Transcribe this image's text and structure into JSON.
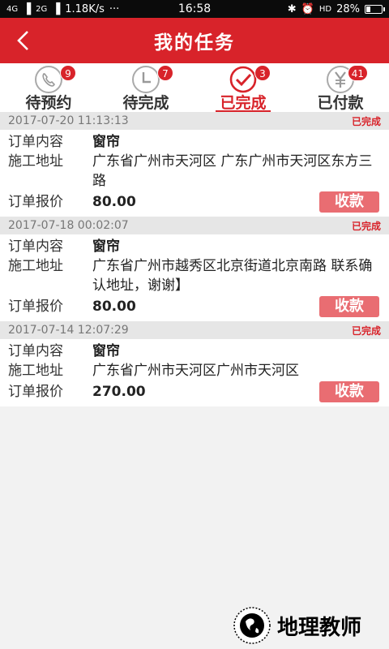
{
  "status_bar": {
    "network": "4G",
    "network2": "2G",
    "speed": "1.18K/s",
    "more": "···",
    "time": "16:58",
    "hd": "HD",
    "battery_text": "28%",
    "battery_level": 0.28
  },
  "header": {
    "title": "我的任务"
  },
  "tabs": [
    {
      "label": "待预约",
      "badge": "9",
      "icon": "phone-icon"
    },
    {
      "label": "待完成",
      "badge": "7",
      "icon": "clock-icon"
    },
    {
      "label": "已完成",
      "badge": "3",
      "icon": "check-icon",
      "active": true
    },
    {
      "label": "已付款",
      "badge": "41",
      "icon": "yen-icon"
    }
  ],
  "labels": {
    "content": "订单内容",
    "address": "施工地址",
    "price": "订单报价",
    "collect": "收款"
  },
  "orders": [
    {
      "datetime": "2017-07-20 11:13:13",
      "status": "已完成",
      "content": "窗帘",
      "address": "广东省广州市天河区 广东广州市天河区东方三路",
      "price": "80.00"
    },
    {
      "datetime": "2017-07-18 00:02:07",
      "status": "已完成",
      "content": "窗帘",
      "address": "广东省广州市越秀区北京街道北京南路 联系确认地址，谢谢】",
      "price": "80.00"
    },
    {
      "datetime": "2017-07-14 12:07:29",
      "status": "已完成",
      "content": "窗帘",
      "address": "广东省广州市天河区广州市天河区",
      "price": "270.00"
    }
  ],
  "watermark": {
    "text": "地理教师"
  },
  "colors": {
    "brand_red": "#d8232a",
    "button_pink": "#e96d72"
  }
}
